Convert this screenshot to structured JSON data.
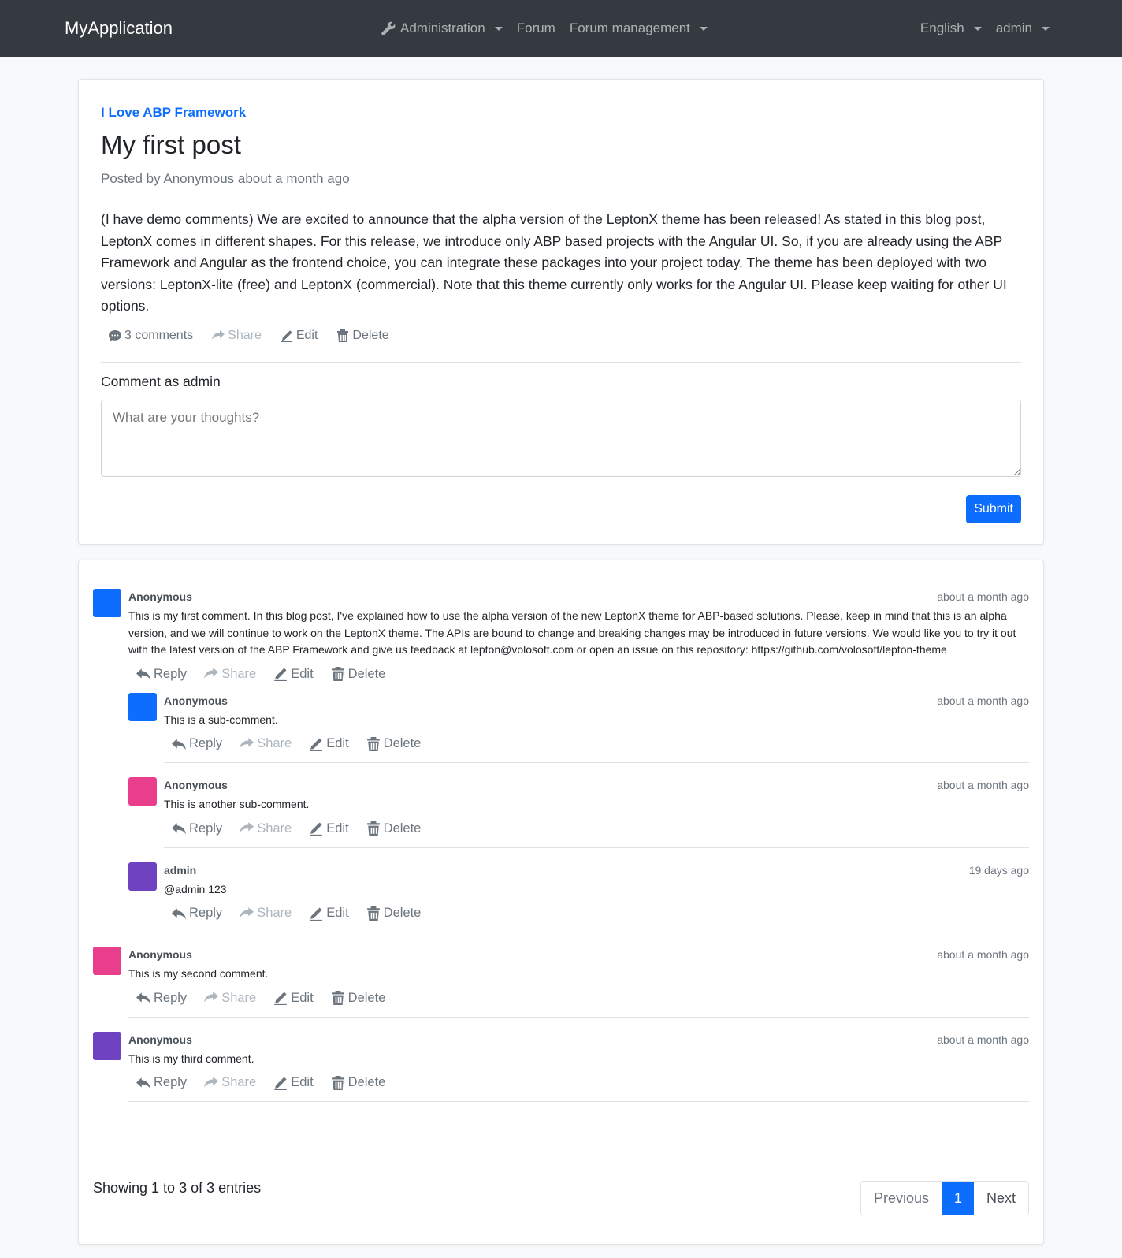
{
  "navbar": {
    "brand": "MyApplication",
    "items": [
      {
        "label": "Administration",
        "icon": "wrench-icon",
        "dropdown": true
      },
      {
        "label": "Forum",
        "dropdown": false
      },
      {
        "label": "Forum management",
        "dropdown": true
      }
    ],
    "language": "English",
    "user": "admin"
  },
  "post": {
    "category": "I Love ABP Framework",
    "title": "My first post",
    "posted": "Posted by Anonymous about a month ago",
    "body": "(I have demo comments) We are excited to announce that the alpha version of the LeptonX theme has been released! As stated in this blog post, LeptonX comes in different shapes. For this release, we introduce only ABP based projects with the Angular UI. So, if you are already using the ABP Framework and Angular as the frontend choice, you can integrate these packages into your project today. The theme has been deployed with two versions: LeptonX-lite (free) and LeptonX (commercial). Note that this theme currently only works for the Angular UI. Please keep waiting for other UI options.",
    "comments_count": "3 comments",
    "share": "Share",
    "edit": "Edit",
    "delete": "Delete"
  },
  "comment_form": {
    "label": "Comment as admin",
    "placeholder": "What are your thoughts?",
    "submit": "Submit"
  },
  "actions": {
    "reply": "Reply",
    "share": "Share",
    "edit": "Edit",
    "delete": "Delete"
  },
  "comments": [
    {
      "author": "Anonymous",
      "time": "about a month ago",
      "avatar_color": "#0d6efd",
      "text": "This is my first comment. In this blog post, I've explained how to use the alpha version of the new LeptonX theme for ABP-based solutions. Please, keep in mind that this is an alpha version, and we will continue to work on the LeptonX theme. The APIs are bound to change and breaking changes may be introduced in future versions. We would like you to try it out with the latest version of the ABP Framework and give us feedback at lepton@volosoft.com or open an issue on this repository: https://github.com/volosoft/lepton-theme",
      "replies": [
        {
          "author": "Anonymous",
          "time": "about a month ago",
          "avatar_color": "#0d6efd",
          "text": "This is a sub-comment."
        },
        {
          "author": "Anonymous",
          "time": "about a month ago",
          "avatar_color": "#e83e8c",
          "text": "This is another sub-comment."
        },
        {
          "author": "admin",
          "time": "19 days ago",
          "avatar_color": "#6f42c1",
          "text": "@admin 123"
        }
      ]
    },
    {
      "author": "Anonymous",
      "time": "about a month ago",
      "avatar_color": "#e83e8c",
      "text": "This is my second comment.",
      "replies": []
    },
    {
      "author": "Anonymous",
      "time": "about a month ago",
      "avatar_color": "#6f42c1",
      "text": "This is my third comment.",
      "replies": []
    }
  ],
  "pagination": {
    "entries": "Showing 1 to 3 of 3 entries",
    "previous": "Previous",
    "current": "1",
    "next": "Next"
  }
}
